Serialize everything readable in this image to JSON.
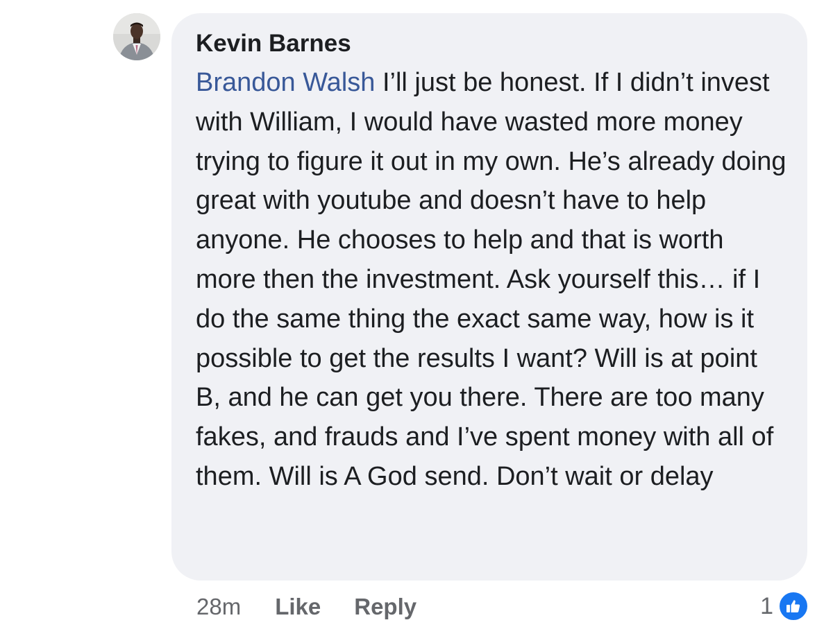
{
  "comment": {
    "author": "Kevin Barnes",
    "mention": "Brandon Walsh",
    "text": " I’ll just be honest. If I didn’t invest with William, I would have wasted more money trying to figure it out in my own. He’s already doing great with youtube and doesn’t have to help anyone. He chooses to help and that is worth more then the investment. Ask yourself this… if I do the same thing the exact same way, how is it possible to get the results I want? Will is at point B, and he can get you there. There are too many fakes, and frauds and I’ve spent money with all of them. Will is A God send. Don’t wait or delay"
  },
  "actions": {
    "timestamp": "28m",
    "like_label": "Like",
    "reply_label": "Reply"
  },
  "reactions": {
    "count": "1",
    "icon": "thumbs-up-icon"
  },
  "colors": {
    "bubble": "#f0f1f5",
    "mention": "#385898",
    "secondary_text": "#65676b",
    "like_badge": "#1877f2"
  }
}
